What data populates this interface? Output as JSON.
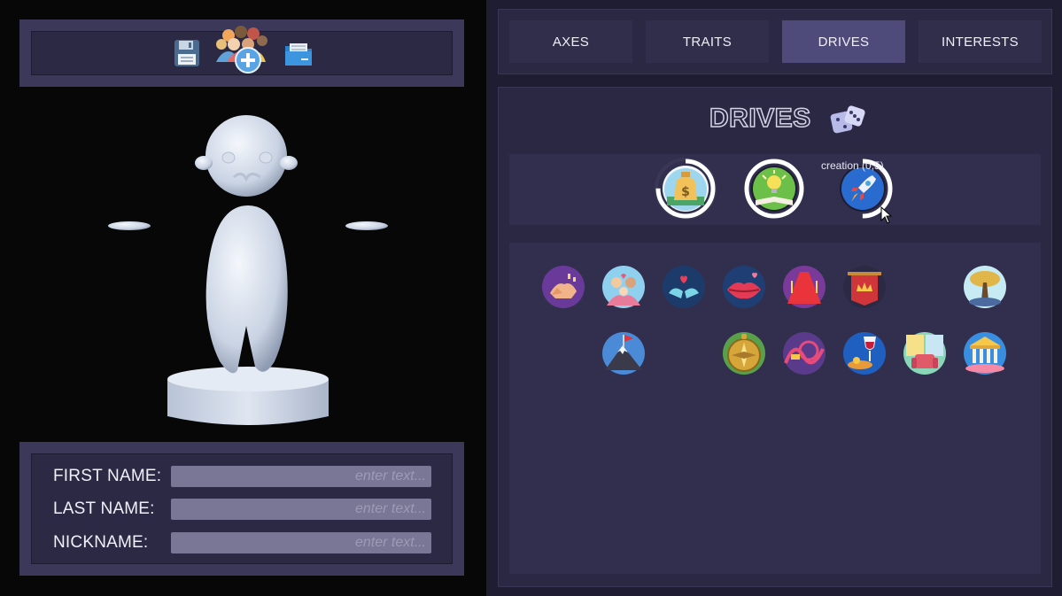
{
  "toolbar": {
    "icons": [
      "floppy-disk-icon",
      "people-group-add-icon",
      "folder-icon"
    ]
  },
  "names": {
    "first_label": "FIRST NAME:",
    "last_label": "LAST NAME:",
    "nick_label": "NICKNAME:",
    "first_value": "",
    "last_value": "",
    "nick_value": "",
    "placeholder": "enter text..."
  },
  "tabs": [
    {
      "label": "AXES",
      "active": false
    },
    {
      "label": "TRAITS",
      "active": false
    },
    {
      "label": "DRIVES",
      "active": true
    },
    {
      "label": "INTERESTS",
      "active": false
    }
  ],
  "drives": {
    "title": "DRIVES",
    "randomize_icon": "dice-icon",
    "selected": [
      {
        "icon": "money-bag-icon",
        "progress": 0.75
      },
      {
        "icon": "lightbulb-book-icon",
        "progress": 1.0
      },
      {
        "icon": "rocket-icon",
        "progress": 0.5
      }
    ],
    "tooltip": "creation (0,5)",
    "grid_icons": [
      "handshake-icon",
      "family-icon",
      "lovebirds-icon",
      "lips-icon",
      "red-carpet-icon",
      "crown-banner-icon",
      "tree-icon",
      "mountain-flag-icon",
      "compass-icon",
      "rollercoaster-icon",
      "wine-food-icon",
      "armchair-room-icon",
      "museum-icon"
    ]
  },
  "colors": {
    "panel_bg": "#3b385a",
    "tab_active": "#4e4a7a",
    "tab_bg": "#312e4c",
    "input_bg": "#7a7696"
  }
}
